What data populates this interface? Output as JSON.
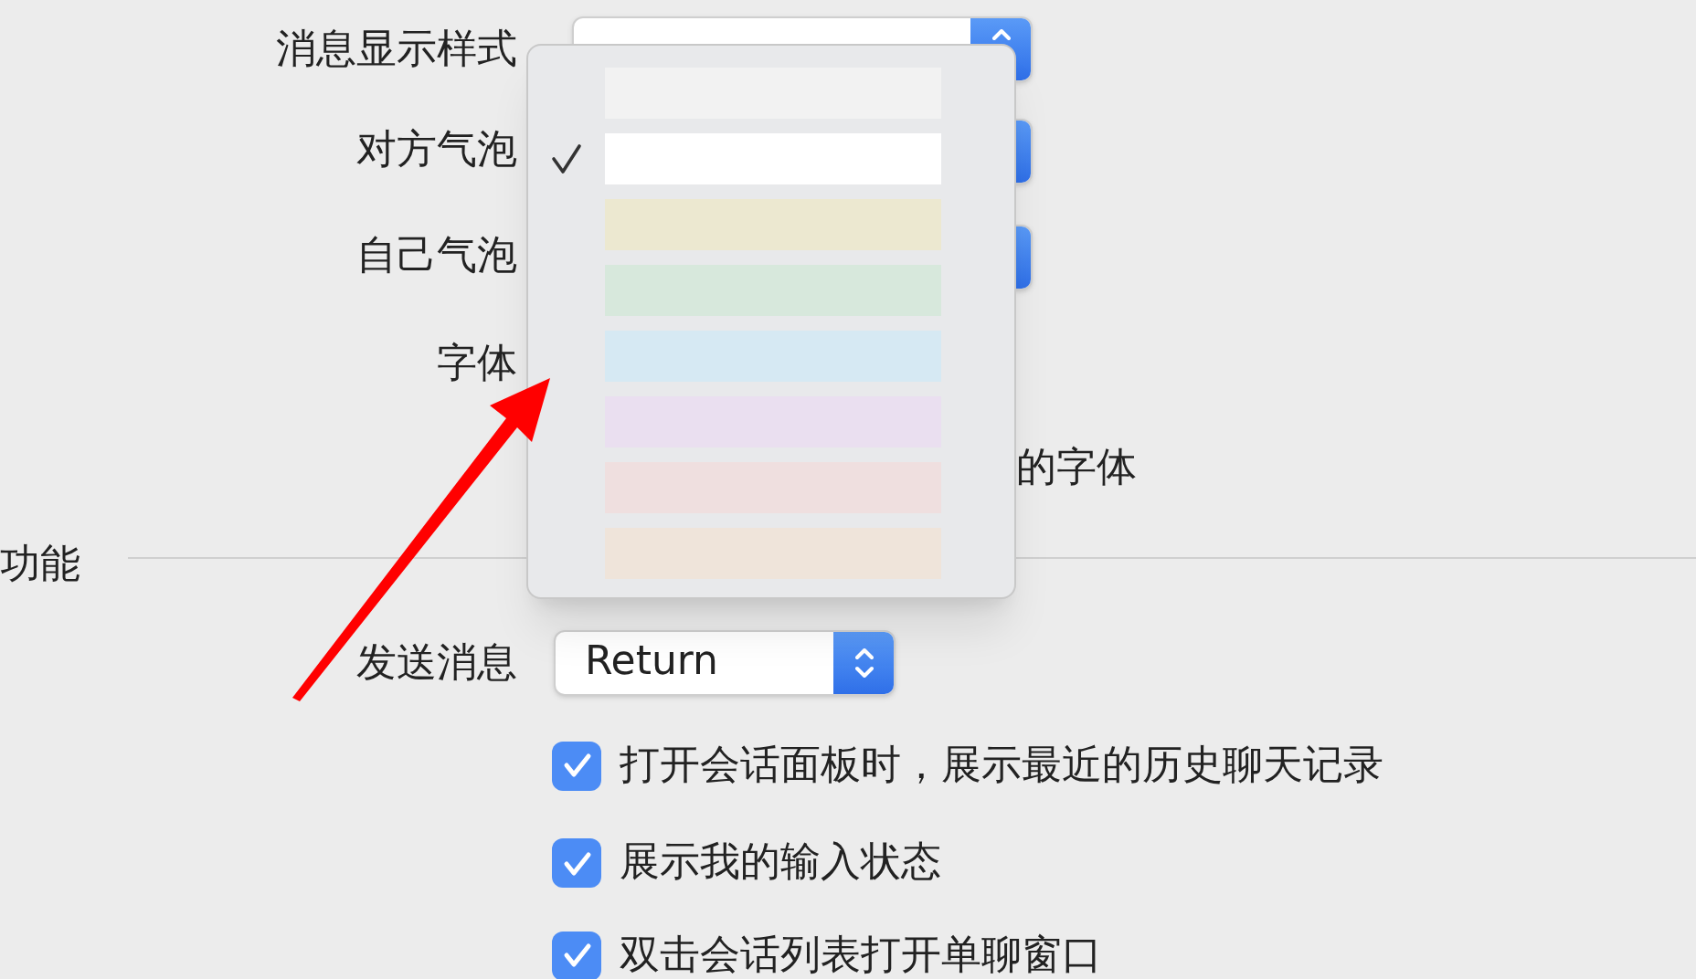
{
  "settings": [
    {
      "kind": "select",
      "label": "消息显示样式"
    },
    {
      "kind": "select",
      "label": "对方气泡"
    },
    {
      "kind": "select",
      "label": "自己气泡"
    },
    {
      "kind": "label",
      "label": "字体"
    },
    {
      "kind": "text",
      "text": "的字体"
    }
  ],
  "section": {
    "title": "功能"
  },
  "send": {
    "label": "发送消息",
    "value": "Return"
  },
  "options": [
    {
      "label": "打开会话面板时，展示最近的历史聊天记录",
      "checked": true
    },
    {
      "label": "展示我的输入状态",
      "checked": true
    },
    {
      "label": "双击会话列表打开单聊窗口",
      "checked": true
    }
  ],
  "color_menu": [
    {
      "color": "#f2f2f2",
      "selected": false
    },
    {
      "color": "#ffffff",
      "selected": true
    },
    {
      "color": "#ece8d0",
      "selected": false
    },
    {
      "color": "#d7e8dc",
      "selected": false
    },
    {
      "color": "#d6e9f3",
      "selected": false
    },
    {
      "color": "#eadff0",
      "selected": false
    },
    {
      "color": "#efdfdf",
      "selected": false
    },
    {
      "color": "#efe4da",
      "selected": false
    }
  ]
}
